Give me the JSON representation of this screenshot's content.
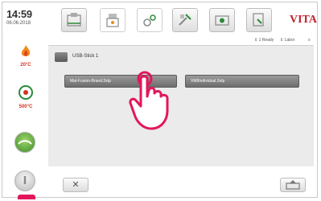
{
  "status": {
    "time": "14:59",
    "date": "06.06.2018"
  },
  "sidebar": {
    "items": [
      {
        "icon": "flame-icon",
        "value": "20°C"
      },
      {
        "icon": "heating-element-icon",
        "value": "500°C"
      }
    ]
  },
  "brand": {
    "name": "VITA",
    "color": "#c0232f"
  },
  "sort": {
    "ready_label": "⇕ 1 Ready",
    "labor_label": "⇕ Labor"
  },
  "browser": {
    "drive_label": "USB-Stick 1",
    "files": [
      "Mat-Fusion-Brand.2elp",
      "VM9Individual.2elp"
    ]
  },
  "accent": "#e2175b"
}
